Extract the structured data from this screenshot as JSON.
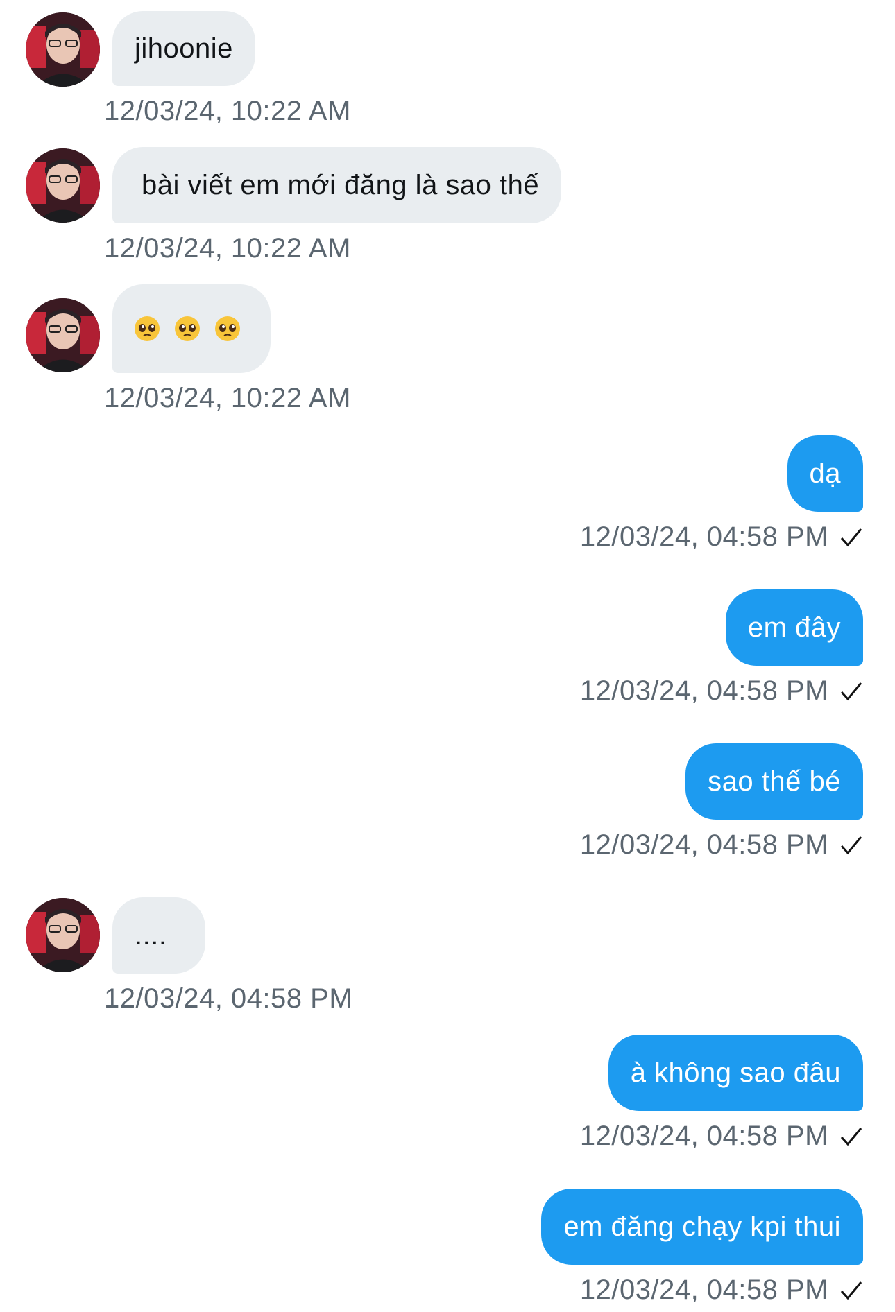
{
  "thread": {
    "messages": [
      {
        "sender": "them",
        "text": "jihoonie",
        "time": "12/03/24, 10:22 AM"
      },
      {
        "sender": "them",
        "text": "bài viết em mới đăng là sao thế",
        "time": "12/03/24, 10:22 AM"
      },
      {
        "sender": "them",
        "emoji": [
          "pleading-face",
          "pleading-face",
          "pleading-face"
        ],
        "time": "12/03/24, 10:22 AM"
      },
      {
        "sender": "me",
        "text": "dạ",
        "time": "12/03/24, 04:58 PM",
        "status": "sent"
      },
      {
        "sender": "me",
        "text": "em đây",
        "time": "12/03/24, 04:58 PM",
        "status": "sent"
      },
      {
        "sender": "me",
        "text": "sao thế bé",
        "time": "12/03/24, 04:58 PM",
        "status": "sent"
      },
      {
        "sender": "them",
        "text": "....",
        "time": "12/03/24, 04:58 PM"
      },
      {
        "sender": "me",
        "text": "à không sao đâu",
        "time": "12/03/24, 04:58 PM",
        "status": "sent"
      },
      {
        "sender": "me",
        "text": "em đăng chạy kpi thui",
        "time": "12/03/24, 04:58 PM",
        "status": "sent"
      }
    ]
  },
  "colors": {
    "incoming_bubble": "#e9edf0",
    "outgoing_bubble": "#1d9bf0",
    "timestamp": "#5b6670",
    "background": "#ffffff"
  },
  "icons": {
    "sent_status": "checkmark-icon",
    "avatar": "user-avatar-photo",
    "emoji": "pleading-face-emoji"
  }
}
